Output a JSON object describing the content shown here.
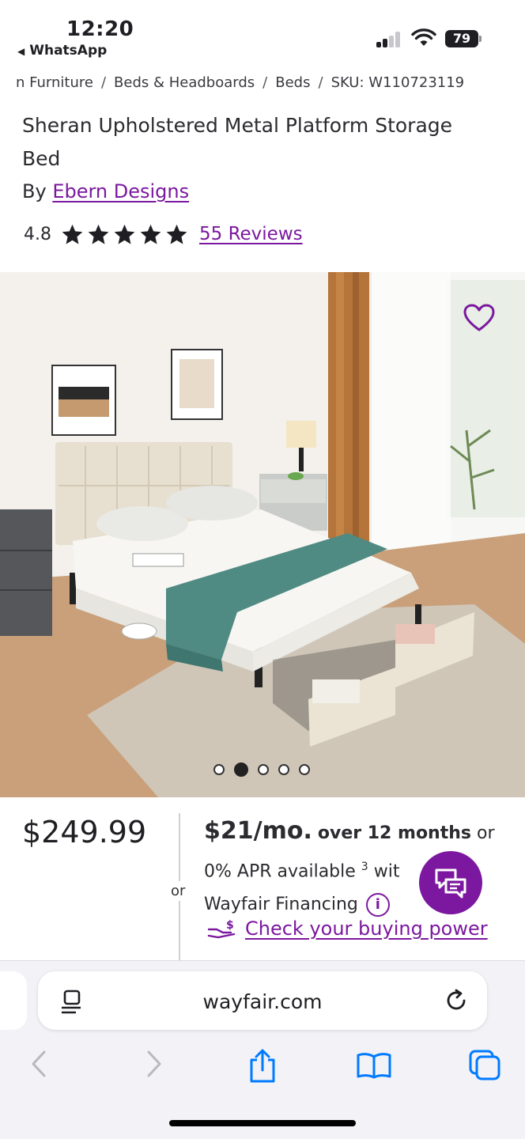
{
  "status": {
    "time": "12:20",
    "back_app": "WhatsApp",
    "battery": "79"
  },
  "breadcrumb": [
    {
      "label": "n Furniture"
    },
    {
      "label": "Beds & Headboards"
    },
    {
      "label": "Beds"
    },
    {
      "label": "SKU: W110723119"
    }
  ],
  "product": {
    "title": "Sheran Upholstered Metal Platform Storage Bed",
    "by_prefix": "By",
    "brand": "Ebern Designs",
    "rating": "4.8",
    "stars": 5,
    "reviews": "55 Reviews"
  },
  "gallery": {
    "image_count": 5,
    "active_index": 1
  },
  "pricing": {
    "price": "$249.99",
    "or": "or",
    "monthly": "$21/mo.",
    "term": "over 12 months",
    "or2": "or",
    "apr": "0% APR available",
    "footnote": "3",
    "with": "wit",
    "financing": "Wayfair Financing",
    "info": "i",
    "buying_power": "Check your buying power"
  },
  "browser": {
    "url": "wayfair.com"
  },
  "colors": {
    "brand_purple": "#7b189f",
    "text": "#2b2b30",
    "browser_bg": "#f2f2f7",
    "ios_blue": "#007aff"
  },
  "icons": [
    "back-arrow-icon",
    "signal-icon",
    "wifi-icon",
    "battery-icon",
    "star-icon",
    "heart-icon",
    "chat-icon",
    "info-icon",
    "hand-money-icon",
    "reader-icon",
    "reload-icon",
    "nav-back-icon",
    "nav-forward-icon",
    "share-icon",
    "bookmarks-icon",
    "tabs-icon"
  ]
}
